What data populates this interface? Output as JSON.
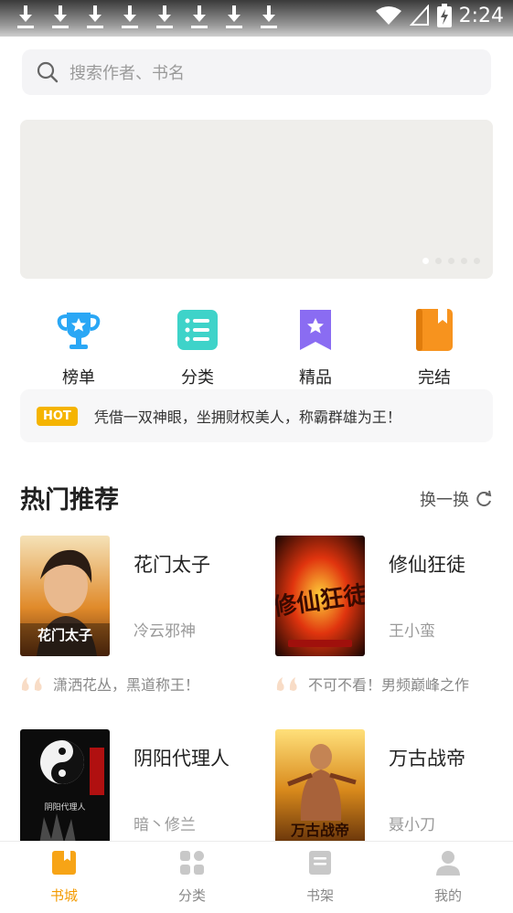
{
  "status_bar": {
    "time": "2:24",
    "download_count": 8
  },
  "search": {
    "placeholder": "搜索作者、书名"
  },
  "banner": {
    "page_count": 5,
    "active_page": 1
  },
  "categories": [
    {
      "label": "榜单",
      "icon": "trophy-icon",
      "color": "#2aa7f5"
    },
    {
      "label": "分类",
      "icon": "list-icon",
      "color": "#3ed3c9"
    },
    {
      "label": "精品",
      "icon": "bookmark-star-icon",
      "color": "#8a6cf2"
    },
    {
      "label": "完结",
      "icon": "book-icon",
      "color": "#f7931e"
    }
  ],
  "hot_notice": {
    "badge": "HOT",
    "text": "凭借一双神眼，坐拥财权美人，称霸群雄为王！"
  },
  "section": {
    "title": "热门推荐",
    "refresh_label": "换一换"
  },
  "books": [
    {
      "title": "花门太子",
      "author": "冷云邪神",
      "desc": "潇洒花丛，黑道称王！",
      "cover_title": "花门太子"
    },
    {
      "title": "修仙狂徒",
      "author": "王小蛮",
      "desc": "不可不看！男频巅峰之作",
      "cover_title": "修仙狂徒"
    },
    {
      "title": "阴阳代理人",
      "author": "暗丶修兰",
      "desc": "",
      "cover_title": "阴阳代理人"
    },
    {
      "title": "万古战帝",
      "author": "聂小刀",
      "desc": "",
      "cover_title": "万古战帝"
    }
  ],
  "tabs": [
    {
      "label": "书城",
      "icon": "bookstore-icon",
      "active": true
    },
    {
      "label": "分类",
      "icon": "category-grid-icon",
      "active": false
    },
    {
      "label": "书架",
      "icon": "bookshelf-icon",
      "active": false
    },
    {
      "label": "我的",
      "icon": "profile-icon",
      "active": false
    }
  ],
  "colors": {
    "accent": "#f39a00",
    "hot_badge": "#f5b400"
  }
}
